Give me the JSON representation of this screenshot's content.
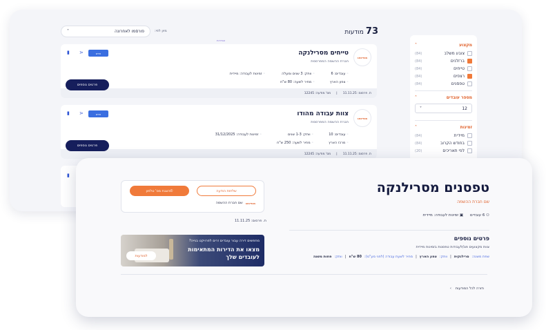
{
  "sidebar": {
    "groups": [
      {
        "title": "מקצוע",
        "items": [
          {
            "label": "צובע משלב",
            "count": "(84)",
            "checked": false
          },
          {
            "label": "ברזלנים",
            "count": "(84)",
            "checked": true
          },
          {
            "label": "טייחים",
            "count": "(84)",
            "checked": false
          },
          {
            "label": "רצפים",
            "count": "(84)",
            "checked": true
          },
          {
            "label": "טפסנים",
            "count": "(84)",
            "checked": false
          }
        ]
      },
      {
        "title": "מספר עובדים",
        "select": "12"
      },
      {
        "title": "זמינות",
        "items": [
          {
            "label": "מיידית",
            "count": "(84)",
            "checked": false
          },
          {
            "label": "בחודש הקרוב",
            "count": "(84)",
            "checked": false
          },
          {
            "label": "לפי תאריכים",
            "count": "(20)",
            "checked": false
          }
        ]
      }
    ]
  },
  "results": {
    "count": "73",
    "count_label": "מודעות",
    "sort_label": "מיון לפי:",
    "sort_value": "פורסמו לאחרונה",
    "tiny": "הגדרות"
  },
  "cards": [
    {
      "title": "טייחים מסרילנקה",
      "subtitle": "חברת ההשמה המפרסמת",
      "logo": "מנדינאו",
      "new": "חדש",
      "meta": [
        "עובדים: 6",
        "וותק: 3 שנים ומעלה",
        "זמינות לעבודה: מיידית",
        "צפון הארץ",
        "מחיר לשעה: 80 ש\"ח"
      ],
      "cta": "פרטים נוספים",
      "footer": [
        "ת. פרסום: 11.11.25",
        "מס' מודעה: 12245"
      ]
    },
    {
      "title": "צוות עבודה מהודו",
      "subtitle": "חברת ההשמה המפרסמת",
      "logo": "מנדינאו",
      "new": "חדש",
      "meta": [
        "עובדים: 10",
        "וותק: 1-3 שנים",
        "זמינות לעבודה: 31/12/2025",
        "מרכז הארץ",
        "מחיר לשעה: 250 ש\"ח"
      ],
      "cta": "פרטים נוספים",
      "footer": [
        "ת. פרסום: 11.11.25",
        "מס' מודעה: 12245"
      ]
    }
  ],
  "detail": {
    "title": "טפסנים מסרילנקה",
    "company_link": "שם חברת ההשמה",
    "meta": [
      "6 עובדים",
      "זמינות לעבודה: מיידית"
    ],
    "more_title": "פרטים נוספים",
    "more_desc": "צוות מקצועים פנו/לעבודות טפסנות בזמינות מיידית",
    "tags": [
      {
        "k": "שפת משנה:",
        "v": "סרילנקית"
      },
      {
        "k": "וותק:",
        "v": "צפון הארץ"
      },
      {
        "k": "אזור:",
        "v": ""
      },
      {
        "k": "מחיר לשעת עבודה (לפני מע\"מ):",
        "v": "80 ש\"ח"
      },
      {
        "k": "וותק:",
        "v": "פחות משנה"
      }
    ],
    "panel": {
      "send_msg": "שליחת הודעה",
      "show_phone": "הצגת מס' טלפון",
      "company": "שם חברת ההשמה",
      "logo": "מנדינאו"
    },
    "published": "ת. פרסום: 11.11.25",
    "banner": {
      "line1": "מחפשים דירה עבור עובדים זרים לפרויקט בנייה?",
      "line2": "מצאו את הדירות המתאימות לעובדים שלך",
      "button": "למודעות"
    },
    "back": "חזרה לכל המודעות"
  }
}
